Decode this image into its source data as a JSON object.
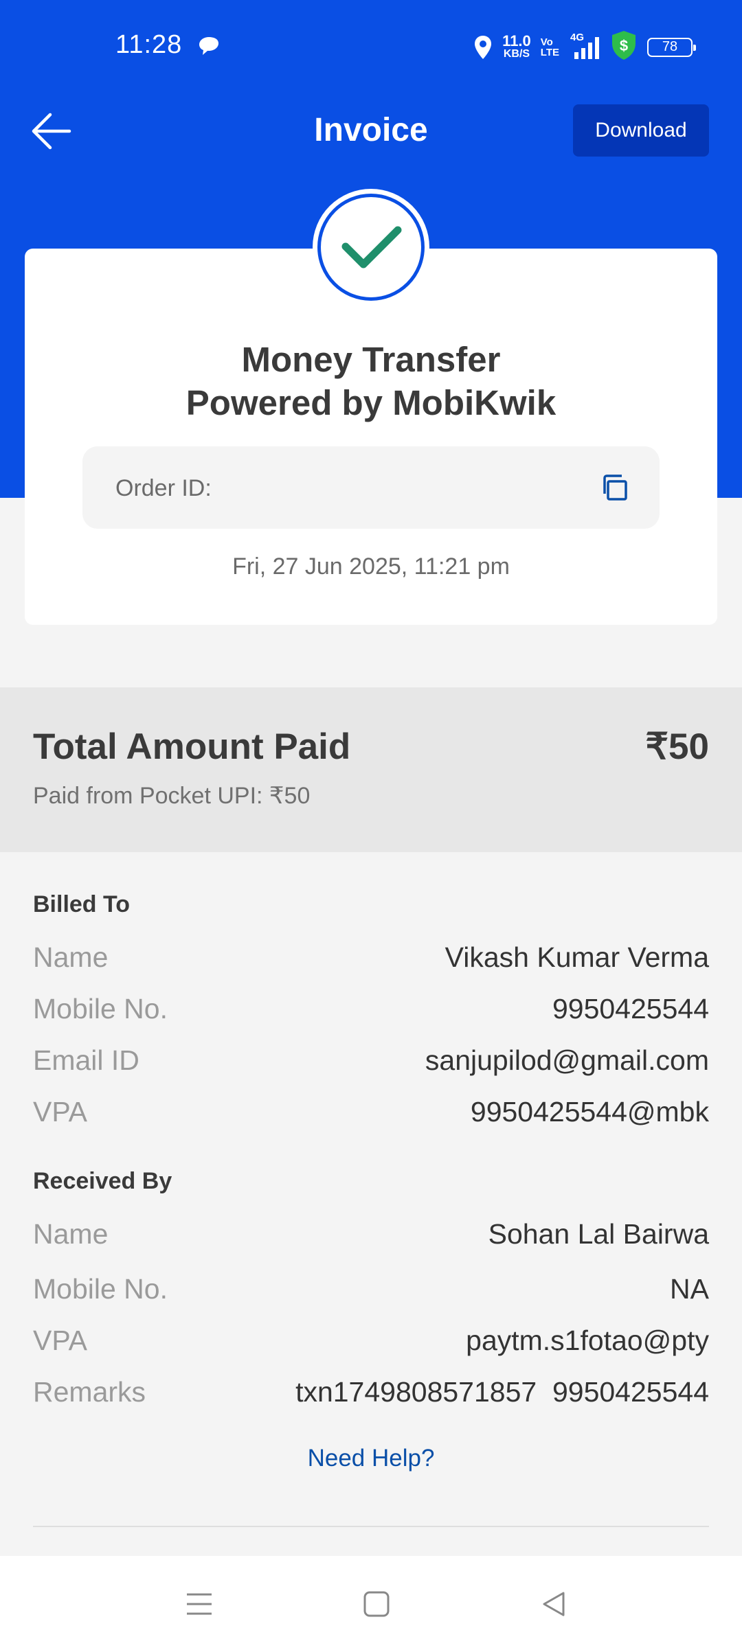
{
  "status_bar": {
    "time": "11:28",
    "speed_value": "11.0",
    "speed_unit": "KB/S",
    "volte_top": "Vo",
    "volte_bottom": "LTE",
    "network": "4G",
    "battery": "78",
    "icons": [
      "chat-icon",
      "location-icon",
      "signal-icon",
      "shield-dollar-icon",
      "battery-icon"
    ]
  },
  "header": {
    "title": "Invoice",
    "download_label": "Download",
    "back_icon": "arrow-left-icon"
  },
  "card": {
    "title_line1": "Money Transfer",
    "title_line2": "Powered by MobiKwik",
    "order_label": "Order ID:",
    "date": "Fri, 27 Jun 2025, 11:21 pm",
    "status_icon": "checkmark-icon"
  },
  "total": {
    "label": "Total Amount Paid",
    "amount": "₹50",
    "sub": "Paid from Pocket UPI: ₹50"
  },
  "billed_to": {
    "title": "Billed To",
    "rows": [
      {
        "key": "Name",
        "value": "Vikash Kumar Verma"
      },
      {
        "key": "Mobile No.",
        "value": "9950425544"
      },
      {
        "key": "Email ID",
        "value": "sanjupilod@gmail.com"
      },
      {
        "key": "VPA",
        "value": "9950425544@mbk"
      }
    ]
  },
  "received_by": {
    "title": "Received By",
    "rows": [
      {
        "key": "Name",
        "value": "Sohan Lal Bairwa"
      },
      {
        "key": "Mobile No.",
        "value": "NA"
      },
      {
        "key": "VPA",
        "value": "paytm.s1fotao@pty"
      },
      {
        "key": "Remarks",
        "value": "txn1749808571857  9950425544"
      }
    ]
  },
  "help_label": "Need Help?",
  "colors": {
    "brand_blue": "#0a4fe4",
    "download_bg": "#0436b6",
    "check_green": "#1f8f6b",
    "link": "#0a4fa8"
  }
}
